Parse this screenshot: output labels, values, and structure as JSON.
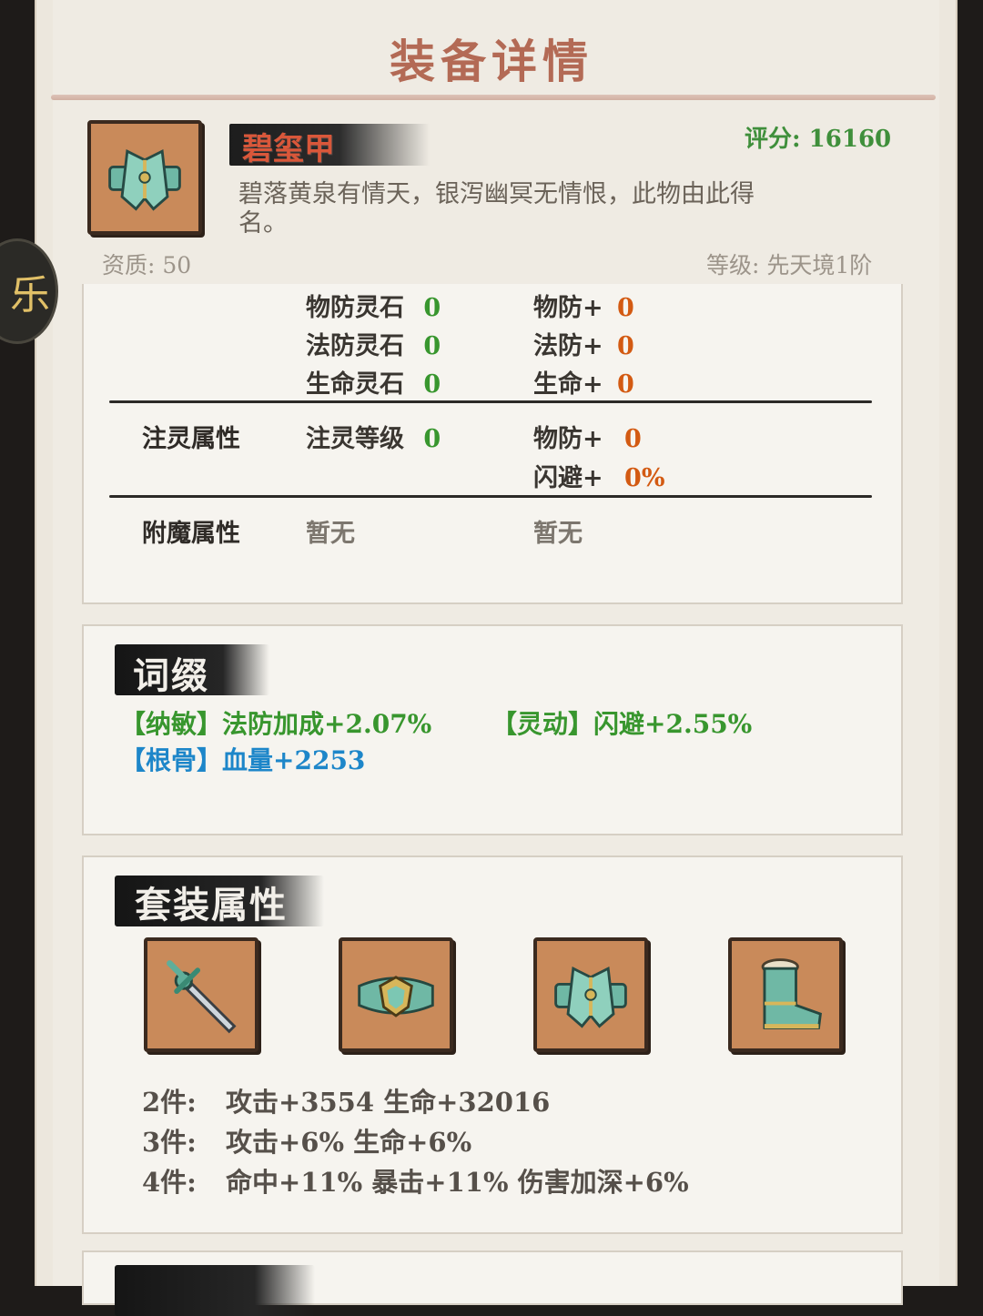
{
  "header": {
    "title": "装备详情"
  },
  "side_button": {
    "glyph": "乐"
  },
  "item": {
    "name": "碧玺甲",
    "score_label": "评分:",
    "score_value": "16160",
    "description": "碧落黄泉有情天，银泻幽冥无情恨，此物由此得名。",
    "quality_label": "资质:",
    "quality_value": "50",
    "level_label": "等级:",
    "level_value": "先天境1阶",
    "icon": "armor-icon"
  },
  "stone_stats": {
    "left": [
      {
        "label": "物防灵石",
        "value": "0"
      },
      {
        "label": "法防灵石",
        "value": "0"
      },
      {
        "label": "生命灵石",
        "value": "0"
      }
    ],
    "right": [
      {
        "label": "物防+",
        "value": "0"
      },
      {
        "label": "法防+",
        "value": "0"
      },
      {
        "label": "生命+",
        "value": "0"
      }
    ]
  },
  "spirit": {
    "title": "注灵属性",
    "level_label": "注灵等级",
    "level_value": "0",
    "stats": [
      {
        "label": "物防+",
        "value": "0"
      },
      {
        "label": "闪避+",
        "value": "0%"
      }
    ]
  },
  "enchant": {
    "title": "附魔属性",
    "left": "暂无",
    "right": "暂无"
  },
  "affixes": {
    "title": "词缀",
    "items": [
      {
        "tag": "【纳敏】",
        "text": "法防加成+2.07%",
        "color": "#38962e"
      },
      {
        "tag": "【灵动】",
        "text": "闪避+2.55%",
        "color": "#38962e"
      },
      {
        "tag": "【根骨】",
        "text": "血量+2253",
        "color": "#1d86c9"
      }
    ]
  },
  "set": {
    "title": "套装属性",
    "pieces": [
      "sword-icon",
      "belt-icon",
      "armor-icon",
      "boots-icon"
    ],
    "bonuses": [
      {
        "count": "2件:",
        "text": "攻击+3554 生命+32016"
      },
      {
        "count": "3件:",
        "text": "攻击+6% 生命+6%"
      },
      {
        "count": "4件:",
        "text": "命中+11% 暴击+11% 伤害加深+6%"
      }
    ]
  },
  "colors": {
    "accent_title": "#b36a55",
    "name": "#d9573a",
    "green": "#38962e",
    "orange": "#d35a12",
    "blue": "#1d86c9"
  }
}
